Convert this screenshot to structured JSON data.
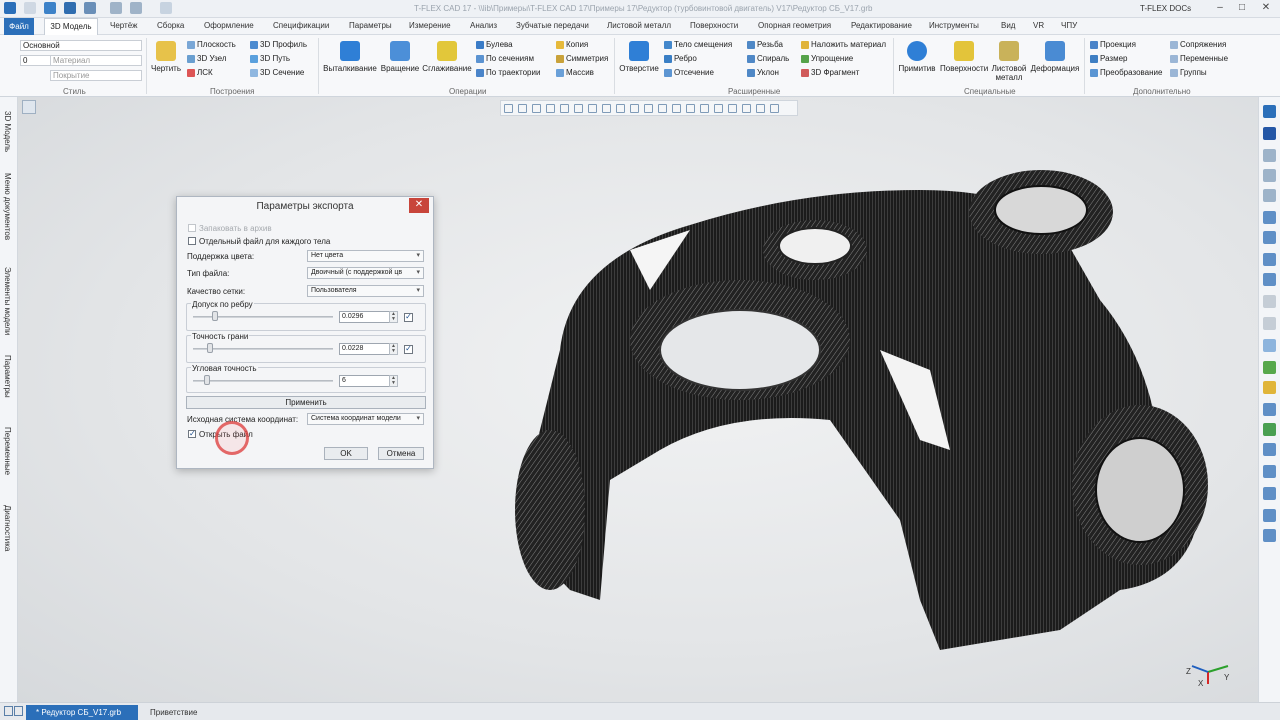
{
  "titlebar": {
    "title": "T-FLEX CAD 17 - \\\\lib\\Примеры\\T-FLEX CAD 17\\Примеры 17\\Редуктор (турбовинтовой двигатель) V17\\Редуктор СБ_V17.grb",
    "docs_label": "T-FLEX DOCs",
    "minimize": "–",
    "maximize": "□",
    "close": "✕"
  },
  "menu": {
    "file": "Файл",
    "tabs": [
      "3D Модель",
      "Чертёж",
      "Сборка",
      "Оформление",
      "Спецификации",
      "Параметры",
      "Измерение",
      "Анализ",
      "Зубчатые передачи",
      "Листовой металл",
      "Поверхности",
      "Опорная геометрия",
      "Редактирование",
      "Инструменты",
      "Вид",
      "VR",
      "ЧПУ"
    ]
  },
  "ribbon": {
    "style": {
      "layer": "Основной",
      "level": "0",
      "material": "Материал",
      "coating": "Покрытие",
      "group": "Стиль"
    },
    "construct": {
      "draw": "Чертить",
      "plane": "Плоскость",
      "node3d": "3D Узел",
      "lcs": "ЛСК",
      "profile3d": "3D Профиль",
      "path3d": "3D Путь",
      "section3d": "3D Сечение",
      "group": "Построения"
    },
    "operations": {
      "extrude": "Выталкивание",
      "revolve": "Вращение",
      "smooth": "Сглаживание",
      "boolean": "Булева",
      "by_sections": "По сечениям",
      "by_path": "По траектории",
      "copy": "Копия",
      "symmetry": "Симметрия",
      "array": "Массив",
      "group": "Операции"
    },
    "extended": {
      "hole": "Отверстие",
      "offset_body": "Тело смещения",
      "rib": "Ребро",
      "cut": "Отсечение",
      "thread": "Резьба",
      "spiral": "Спираль",
      "draft": "Уклон",
      "apply_material": "Наложить материал",
      "simplify": "Упрощение",
      "fragment3d": "3D Фрагмент",
      "group": "Расширенные"
    },
    "special": {
      "primitives": "Примитив",
      "surfaces": "Поверхности",
      "sheet_metal": "Листовой металл",
      "deform": "Деформация",
      "group": "Специальные"
    },
    "extra": {
      "projection": "Проекция",
      "size": "Размер",
      "transform": "Преобразование",
      "mate": "Сопряжения",
      "variables": "Переменные",
      "groups": "Группы",
      "group": "Дополнительно"
    }
  },
  "left_panel": [
    "3D Модель",
    "Меню документов",
    "Элементы модели",
    "Параметры",
    "Переменные",
    "Диагностика"
  ],
  "dialog": {
    "title": "Параметры экспорта",
    "close": "✕",
    "pack_archive": "Запаковать в архив",
    "separate_file": "Отдельный файл для каждого тела",
    "color_support_label": "Поддержка цвета:",
    "color_support_value": "Нет цвета",
    "file_type_label": "Тип файла:",
    "file_type_value": "Двоичный (с поддержкой цв",
    "mesh_quality_label": "Качество сетки:",
    "mesh_quality_value": "Пользователя",
    "edge_tolerance_label": "Допуск по ребру",
    "edge_tolerance_value": "0.0296",
    "face_accuracy_label": "Точность грани",
    "face_accuracy_value": "0.0228",
    "angular_accuracy_label": "Угловая точность",
    "angular_accuracy_value": "6",
    "apply": "Применить",
    "source_cs_label": "Исходная система координат:",
    "source_cs_value": "Система координат модели",
    "open_file": "Открыть файл",
    "ok": "OK",
    "cancel": "Отмена"
  },
  "status": {
    "doc_tab": "* Редуктор СБ_V17.grb",
    "welcome": "Приветствие"
  },
  "axes": {
    "x": "X",
    "y": "Y",
    "z": "Z"
  },
  "colors": {
    "accent": "#2b6fb9",
    "close_red": "#c8453b",
    "click_marker": "#dc3c3c"
  }
}
